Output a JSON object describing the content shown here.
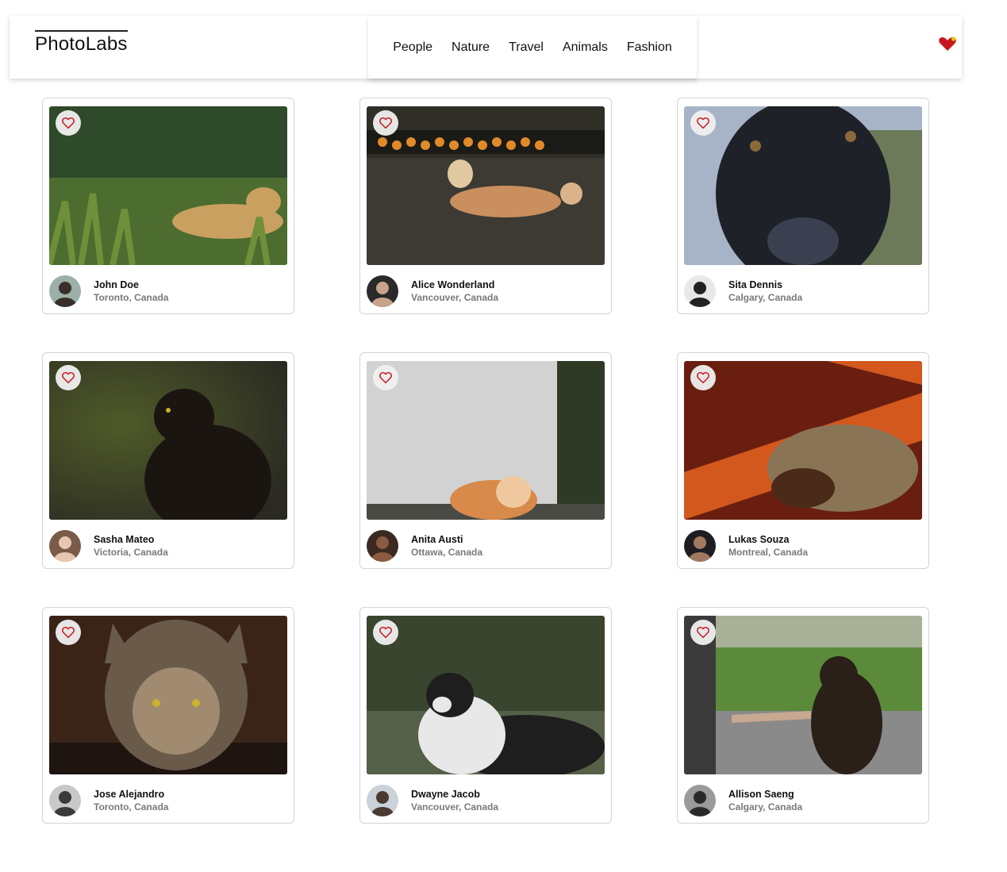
{
  "app": {
    "logo": "PhotoLabs"
  },
  "nav": {
    "topics": [
      "People",
      "Nature",
      "Travel",
      "Animals",
      "Fashion"
    ]
  },
  "colors": {
    "heart": "#c8161d",
    "badge_dot": "#f2c300"
  },
  "photos": [
    {
      "name": "John Doe",
      "location": "Toronto, Canada",
      "subject": "jaguar",
      "palette": [
        "#2f4a2a",
        "#6f8f3a",
        "#c9a060",
        "#4c6d2f"
      ],
      "avatar": [
        "#9ab0a8",
        "#3a2e2a"
      ]
    },
    {
      "name": "Alice Wonderland",
      "location": "Vancouver, Canada",
      "subject": "dog-on-grass",
      "palette": [
        "#2f2f28",
        "#e08a2a",
        "#c98f5e",
        "#3c3a33"
      ],
      "avatar": [
        "#2a2a2a",
        "#c9a38c"
      ]
    },
    {
      "name": "Sita Dennis",
      "location": "Calgary, Canada",
      "subject": "black-dog-closeup",
      "palette": [
        "#1e2127",
        "#3b4050",
        "#a7b4c7",
        "#8a6a3a"
      ],
      "avatar": [
        "#e8e8e8",
        "#222222"
      ]
    },
    {
      "name": "Sasha Mateo",
      "location": "Victoria, Canada",
      "subject": "black-cat",
      "palette": [
        "#3b4a1e",
        "#4f5a28",
        "#1b1512",
        "#2a2a22"
      ],
      "avatar": [
        "#7a5a48",
        "#e8c7b0"
      ]
    },
    {
      "name": "Anita Austi",
      "location": "Ottawa, Canada",
      "subject": "orange-cat-wall",
      "palette": [
        "#b8b8b8",
        "#d2d2d2",
        "#d88a4a",
        "#2e3a26"
      ],
      "avatar": [
        "#3a2a22",
        "#8a5a42"
      ]
    },
    {
      "name": "Lukas Souza",
      "location": "Montreal, Canada",
      "subject": "tabby-on-rug",
      "palette": [
        "#6a1e10",
        "#d2581e",
        "#8a7456",
        "#4a2a18"
      ],
      "avatar": [
        "#1e1e22",
        "#a07a60"
      ]
    },
    {
      "name": "Jose Alejandro",
      "location": "Toronto, Canada",
      "subject": "tabby-drinking",
      "palette": [
        "#3a2418",
        "#6a5a4a",
        "#a08a70",
        "#1e1410"
      ],
      "avatar": [
        "#c8c8c8",
        "#3a3a3a"
      ]
    },
    {
      "name": "Dwayne Jacob",
      "location": "Vancouver, Canada",
      "subject": "collie",
      "palette": [
        "#3a4530",
        "#556048",
        "#e8e8e8",
        "#1e1e1e"
      ],
      "avatar": [
        "#c8d2d8",
        "#4a3a30"
      ]
    },
    {
      "name": "Allison Saeng",
      "location": "Calgary, Canada",
      "subject": "dog-paw",
      "palette": [
        "#a8b098",
        "#5a8a3a",
        "#2a2018",
        "#8a8a8a"
      ],
      "avatar": [
        "#9a9a9a",
        "#2a2a2a"
      ]
    }
  ]
}
